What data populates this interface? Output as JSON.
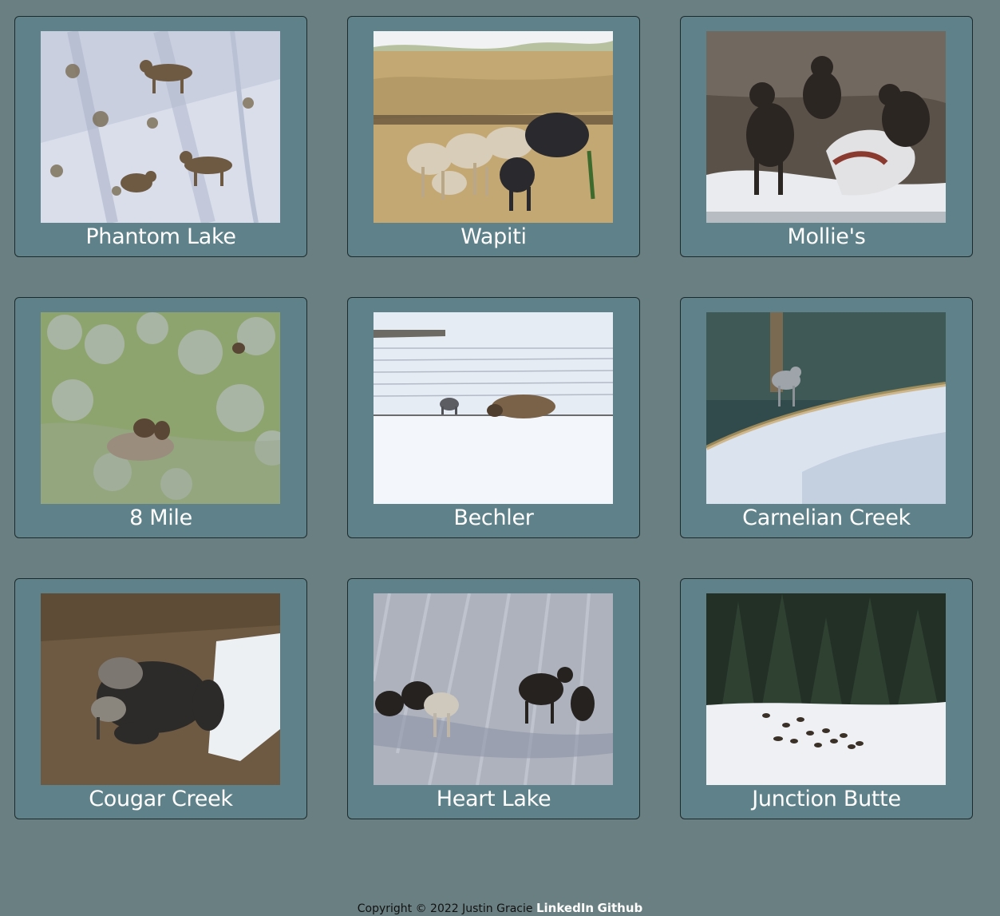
{
  "packs": [
    {
      "name": "Phantom Lake",
      "image": "wolves-on-snowy-slope-photo"
    },
    {
      "name": "Wapiti",
      "image": "wolf-pack-on-grass-photo"
    },
    {
      "name": "Mollie's",
      "image": "dark-wolves-snowy-carcass-photo"
    },
    {
      "name": "8 Mile",
      "image": "wolves-on-sage-hillside-photo"
    },
    {
      "name": "Bechler",
      "image": "wolf-and-bison-in-snow-photo"
    },
    {
      "name": "Carnelian Creek",
      "image": "wolf-on-snowy-ridge-photo"
    },
    {
      "name": "Cougar Creek",
      "image": "huddled-wolf-pack-photo"
    },
    {
      "name": "Heart Lake",
      "image": "wolves-on-snow-field-photo"
    },
    {
      "name": "Junction Butte",
      "image": "pack-running-by-forest-photo"
    }
  ],
  "footer": {
    "copyright": "Copyright © 2022 Justin Gracie",
    "linkedin": "LinkedIn",
    "github": "Github"
  },
  "colors": {
    "background": "#6a7f81",
    "card": "#5f828a",
    "border": "#1d2a2c"
  }
}
